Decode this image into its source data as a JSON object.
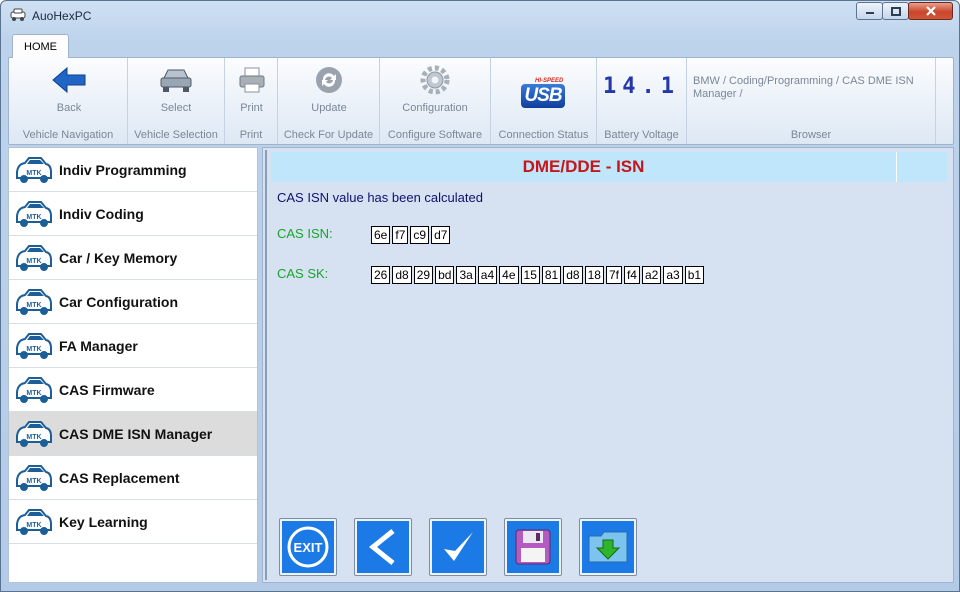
{
  "window": {
    "title": "AuoHexPC"
  },
  "ribbon": {
    "tab": "HOME",
    "groups": {
      "back": {
        "button": "Back",
        "caption": "Vehicle Navigation"
      },
      "select": {
        "button": "Select",
        "caption": "Vehicle Selection"
      },
      "print": {
        "button": "Print",
        "caption": "Print"
      },
      "update": {
        "button": "Update",
        "caption": "Check For Update"
      },
      "configuration": {
        "button": "Configuration",
        "caption": "Configure Software"
      },
      "connection": {
        "usb_badge": "USB",
        "usb_hispeed": "HI-SPEED",
        "caption": "Connection Status"
      },
      "battery": {
        "value": "14.1",
        "caption": "Battery Voltage"
      },
      "browser": {
        "path": "BMW / Coding/Programming / CAS DME ISN Manager /",
        "caption": "Browser"
      }
    }
  },
  "sidebar": {
    "car_badge": "MTK",
    "items": [
      {
        "label": "Indiv Programming",
        "active": false
      },
      {
        "label": "Indiv Coding",
        "active": false
      },
      {
        "label": "Car / Key Memory",
        "active": false
      },
      {
        "label": "Car Configuration",
        "active": false
      },
      {
        "label": "FA Manager",
        "active": false
      },
      {
        "label": "CAS Firmware",
        "active": false
      },
      {
        "label": "CAS DME ISN Manager",
        "active": true
      },
      {
        "label": "CAS Replacement",
        "active": false
      },
      {
        "label": "Key Learning",
        "active": false
      }
    ]
  },
  "main": {
    "title": "DME/DDE - ISN",
    "status": "CAS ISN value has been calculated",
    "cas_isn": {
      "label": "CAS ISN:",
      "bytes": [
        "6e",
        "f7",
        "c9",
        "d7"
      ]
    },
    "cas_sk": {
      "label": "CAS SK:",
      "bytes": [
        "26",
        "d8",
        "29",
        "bd",
        "3a",
        "a4",
        "4e",
        "15",
        "81",
        "d8",
        "18",
        "7f",
        "f4",
        "a2",
        "a3",
        "b1"
      ]
    },
    "actions": {
      "exit_label": "EXIT"
    }
  },
  "colors": {
    "title_red": "#c5161b",
    "ok_green": "#16a72a",
    "status_navy": "#12106e",
    "action_blue": "#1c7ae6",
    "header_bar": "#bfe6fb"
  }
}
